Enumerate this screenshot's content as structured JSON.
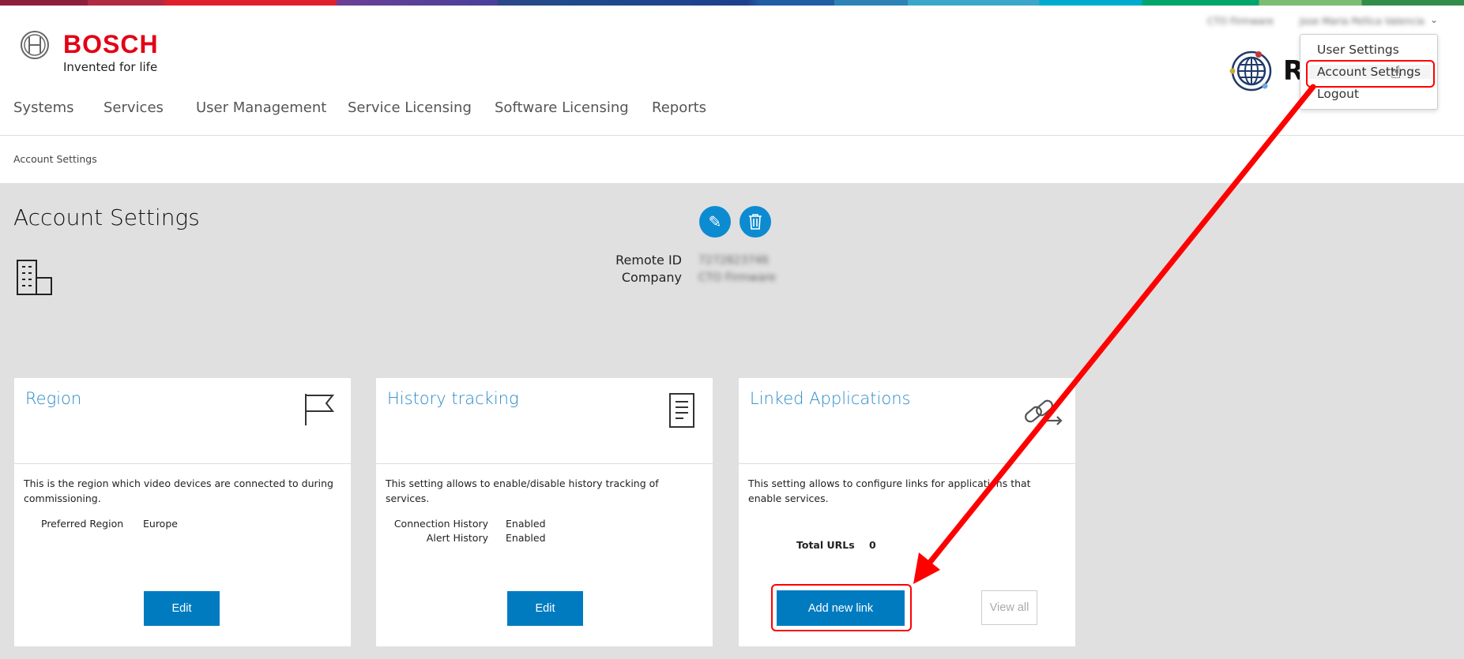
{
  "brand": {
    "name": "BOSCH",
    "tagline": "Invented for life",
    "app_initial": "R"
  },
  "user_bar": {
    "company": "CTO Firmware",
    "user": "Jose Maria Pellica Valencia"
  },
  "nav": [
    "Systems",
    "Services",
    "User Management",
    "Service Licensing",
    "Software Licensing",
    "Reports"
  ],
  "user_menu": {
    "items": [
      "User Settings",
      "Account Settings",
      "Logout"
    ],
    "highlighted": "Account Settings"
  },
  "breadcrumb": "Account Settings",
  "page": {
    "title": "Account Settings",
    "fields": {
      "remote_id_label": "Remote ID",
      "remote_id_value": "7272823746",
      "company_label": "Company",
      "company_value": "CTO Firmware"
    }
  },
  "cards": {
    "region": {
      "title": "Region",
      "desc": "This is the region which video devices are connected to during commissioning.",
      "label": "Preferred Region",
      "value": "Europe",
      "button": "Edit"
    },
    "history": {
      "title": "History tracking",
      "desc": "This setting allows to enable/disable history tracking of services.",
      "rows": [
        {
          "label": "Connection History",
          "value": "Enabled"
        },
        {
          "label": "Alert History",
          "value": "Enabled"
        }
      ],
      "button": "Edit"
    },
    "linked": {
      "title": "Linked Applications",
      "desc": "This setting allows to configure links for applications that enable services.",
      "label": "Total URLs",
      "value": "0",
      "add_button": "Add new link",
      "view_button": "View all"
    }
  },
  "colors": {
    "accent": "#007bc0",
    "title_blue": "#2a8ac9",
    "annotation": "#ff0000",
    "brand_red": "#e20015"
  }
}
